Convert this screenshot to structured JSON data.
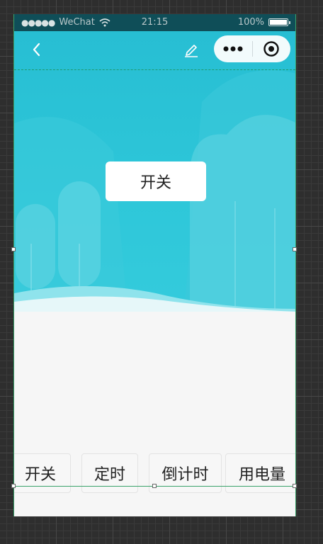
{
  "status_bar": {
    "signal": "●●●●●",
    "carrier": "WeChat",
    "time": "21:15",
    "battery": "100%"
  },
  "nav": {
    "back_icon": "chevron-left-icon",
    "edit_icon": "pencil-icon",
    "menu_icon": "more-dots-icon",
    "close_icon": "record-icon"
  },
  "main": {
    "power_button_label": "开关"
  },
  "tabs": [
    {
      "label": "开关"
    },
    {
      "label": "定时"
    },
    {
      "label": "倒计时"
    },
    {
      "label": "用电量"
    }
  ],
  "colors": {
    "hero": "#2ec7d9",
    "status_bar": "#0f4e58",
    "page_bg": "#f6f6f6"
  }
}
